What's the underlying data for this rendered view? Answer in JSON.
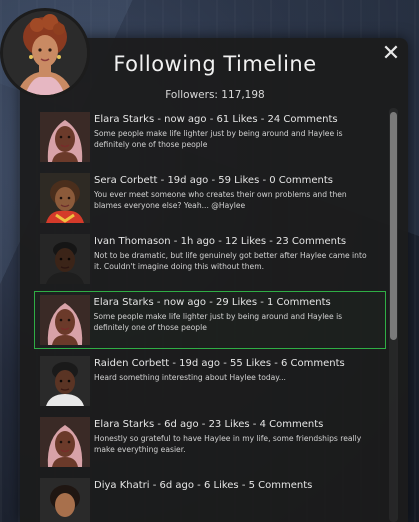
{
  "header": {
    "title": "Following Timeline",
    "followers": "Followers: 117,198",
    "close_symbol": "✕"
  },
  "posts": [
    {
      "head": "Elara Starks - now ago - 61 Likes - 24 Comments",
      "body": "Some people make life lighter just by being around and Haylee is definitely one of those people",
      "avatar": "elara-avatar",
      "selected": false
    },
    {
      "head": "Sera Corbett - 19d ago - 59 Likes - 0 Comments",
      "body": "You ever meet someone who creates their own problems and then blames everyone else? Yeah... @Haylee",
      "avatar": "sera-avatar",
      "selected": false
    },
    {
      "head": "Ivan Thomason - 1h ago - 12 Likes - 23 Comments",
      "body": "Not to be dramatic, but life genuinely got better after Haylee came into it. Couldn't imagine doing this without them.",
      "avatar": "ivan-avatar",
      "selected": false
    },
    {
      "head": "Elara Starks - now ago - 29 Likes - 1 Comments",
      "body": "Some people make life lighter just by being around and Haylee is definitely one of those people",
      "avatar": "elara-avatar",
      "selected": true
    },
    {
      "head": "Raiden Corbett - 19d ago - 55 Likes - 6 Comments",
      "body": "Heard something interesting about Haylee today...",
      "avatar": "raiden-avatar",
      "selected": false
    },
    {
      "head": "Elara Starks - 6d ago - 23 Likes - 4 Comments",
      "body": "Honestly so grateful to have Haylee in my life, some friendships really make everything easier.",
      "avatar": "elara-avatar",
      "selected": false
    },
    {
      "head": "Diya Khatri - 6d ago - 6 Likes - 5 Comments",
      "body": "",
      "avatar": "diya-avatar",
      "selected": false
    }
  ],
  "colors": {
    "panel_bg": "#1c1c1c",
    "selected_border": "#2fae45",
    "text_primary": "#e6e6e6"
  }
}
